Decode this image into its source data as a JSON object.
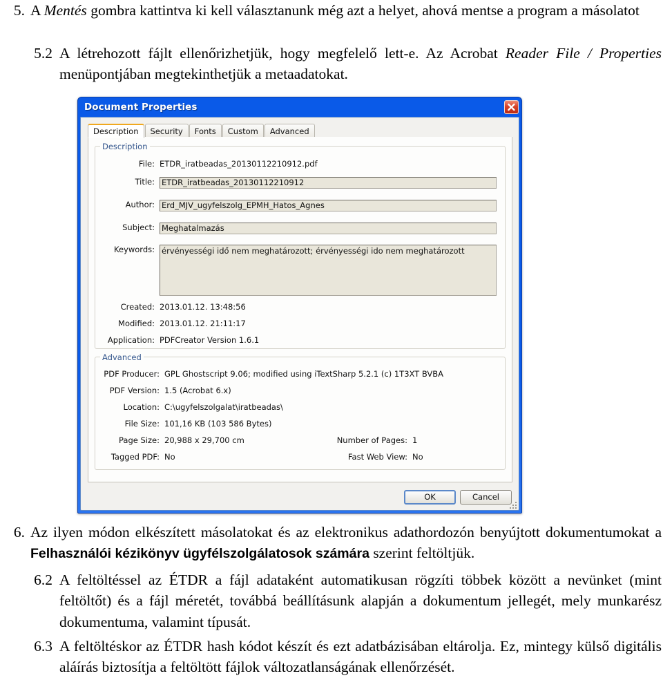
{
  "document": {
    "items": [
      {
        "id": "5",
        "number": "5.",
        "text_parts": [
          "A ",
          "Mentés",
          " gombra kattintva ki kell választanunk még azt a helyet, ahová mentse a program a másolatot"
        ],
        "emphasis": "Mentés"
      },
      {
        "id": "5.2",
        "number": "5.2",
        "lead": "A létrehozott fájlt ellenőrizhetjük, hogy megfelelő lett-e. Az Acrobat ",
        "emphasis": "Reader File / Properties",
        "tail": " menüpontjában megtekinthetjük a metaadatokat."
      },
      {
        "id": "6",
        "number": "6.",
        "lead": "Az ilyen módon elkészített másolatokat és az elektronikus adathordozón benyújtott dokumentumokat a ",
        "strong": "Felhasználói kézikönyv ügyfélszolgálatosok számára",
        "tail": " szerint feltöltjük."
      },
      {
        "id": "6.2",
        "number": "6.2",
        "text": "A feltöltéssel az ÉTDR a fájl adataként automatikusan rögzíti többek között a nevünket (mint feltöltőt) és a fájl méretét, továbbá beállításunk alapján a dokumentum jellegét, mely munkarész dokumentuma, valamint típusát."
      },
      {
        "id": "6.3",
        "number": "6.3",
        "text": "A feltöltéskor az ÉTDR hash kódot készít és ezt adatbázisában eltárolja. Ez, mintegy külső digitális aláírás biztosítja a feltöltött fájlok változatlanságának ellenőrzését."
      }
    ]
  },
  "dialog": {
    "title": "Document Properties",
    "close_icon": "close-icon",
    "tabs": [
      {
        "label": "Description",
        "active": true
      },
      {
        "label": "Security",
        "active": false
      },
      {
        "label": "Fonts",
        "active": false
      },
      {
        "label": "Custom",
        "active": false
      },
      {
        "label": "Advanced",
        "active": false
      }
    ],
    "description": {
      "group_label": "Description",
      "file_label": "File:",
      "file_value": "ETDR_iratbeadas_20130112210912.pdf",
      "title_label": "Title:",
      "title_value": "ETDR_iratbeadas_20130112210912",
      "author_label": "Author:",
      "author_value": "Erd_MJV_ugyfelszolg_EPMH_Hatos_Agnes",
      "subject_label": "Subject:",
      "subject_value": "Meghatalmazás",
      "keywords_label": "Keywords:",
      "keywords_value": "érvényességi idő nem meghatározott; érvényességi ido nem meghatározott",
      "created_label": "Created:",
      "created_value": "2013.01.12. 13:48:56",
      "modified_label": "Modified:",
      "modified_value": "2013.01.12. 21:11:17",
      "application_label": "Application:",
      "application_value": "PDFCreator Version 1.6.1"
    },
    "advanced": {
      "group_label": "Advanced",
      "producer_label": "PDF Producer:",
      "producer_value": "GPL Ghostscript 9.06; modified using iTextSharp 5.2.1 (c) 1T3XT BVBA",
      "version_label": "PDF Version:",
      "version_value": "1.5 (Acrobat 6.x)",
      "location_label": "Location:",
      "location_value": "C:\\ugyfelszolgalat\\iratbeadas\\",
      "filesize_label": "File Size:",
      "filesize_value": "101,16 KB (103 586 Bytes)",
      "pagesize_label": "Page Size:",
      "pagesize_value": "20,988 x 29,700 cm",
      "tagged_label": "Tagged PDF:",
      "tagged_value": "No",
      "numpages_label": "Number of Pages:",
      "numpages_value": "1",
      "fastweb_label": "Fast Web View:",
      "fastweb_value": "No"
    },
    "buttons": {
      "ok_label": "OK",
      "cancel_label": "Cancel"
    },
    "colors": {
      "titlebar_blue": "#0a5ae8",
      "active_tab_accent": "#f0a81e",
      "field_background": "#e9e6da",
      "group_label_blue": "#33558c",
      "close_button_red": "#d8432a"
    }
  }
}
